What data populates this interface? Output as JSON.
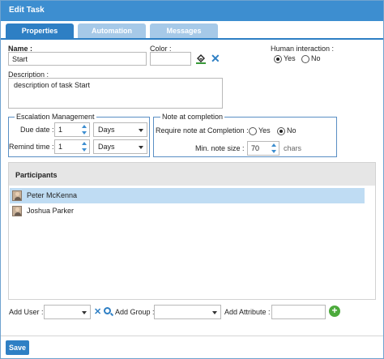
{
  "window": {
    "title": "Edit Task"
  },
  "tabs": [
    {
      "label": "Properties",
      "active": true
    },
    {
      "label": "Automation",
      "active": false
    },
    {
      "label": "Messages",
      "active": false
    }
  ],
  "form": {
    "name_label": "Name :",
    "name_value": "Start",
    "color_label": "Color :",
    "color_value": "",
    "human_interaction_label": "Human interaction :",
    "human_yes": "Yes",
    "human_no": "No",
    "human_selected": "Yes",
    "description_label": "Description :",
    "description_value": "description of task Start"
  },
  "escalation": {
    "legend": "Escalation Management",
    "due_date_label": "Due date :",
    "due_date_value": "1",
    "due_date_unit": "Days",
    "remind_label": "Remind time :",
    "remind_value": "1",
    "remind_unit": "Days"
  },
  "note": {
    "legend": "Note at completion",
    "require_label": "Require note at Completion :",
    "yes": "Yes",
    "no": "No",
    "selected": "No",
    "min_size_label": "Min. note size :",
    "min_size_value": "70",
    "min_size_unit": "chars"
  },
  "participants": {
    "header": "Participants",
    "rows": [
      {
        "name": "Peter McKenna",
        "selected": true
      },
      {
        "name": "Joshua Parker",
        "selected": false
      }
    ]
  },
  "bottom": {
    "add_user_label": "Add User :",
    "add_group_label": "Add Group :",
    "add_attribute_label": "Add Attribute :"
  },
  "footer": {
    "save_label": "Save"
  },
  "colors": {
    "accent": "#2e7fc4",
    "titlebar": "#3d8ed0",
    "selected_row": "#bfdcf3",
    "tab_inactive": "#a6c9e8"
  },
  "icons": [
    "paint-bucket-icon",
    "clear-x-icon",
    "chevron-down-icon",
    "spinner-arrows-icon",
    "search-icon",
    "add-icon",
    "avatar-icon"
  ]
}
